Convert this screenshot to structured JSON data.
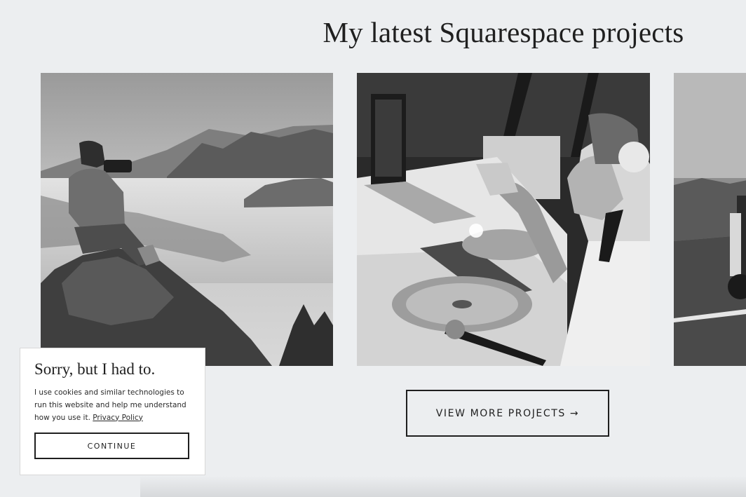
{
  "section": {
    "title": "My latest Squarespace projects"
  },
  "gallery": {
    "slides": [
      {
        "subject": "photographer on mountain above clouds"
      },
      {
        "subject": "dj at turntables with laptop"
      },
      {
        "subject": "road with truck"
      }
    ]
  },
  "more_button": {
    "label": "VIEW MORE PROJECTS",
    "arrow": "→"
  },
  "cookie": {
    "title": "Sorry, but I had to.",
    "text": "I use cookies and similar technologies to run this website and help me understand how you use it.",
    "link_label": "Privacy Policy",
    "button_label": "CONTINUE"
  },
  "colors": {
    "background": "#eceef0",
    "text": "#1f1f1f",
    "panel": "#ffffff"
  }
}
